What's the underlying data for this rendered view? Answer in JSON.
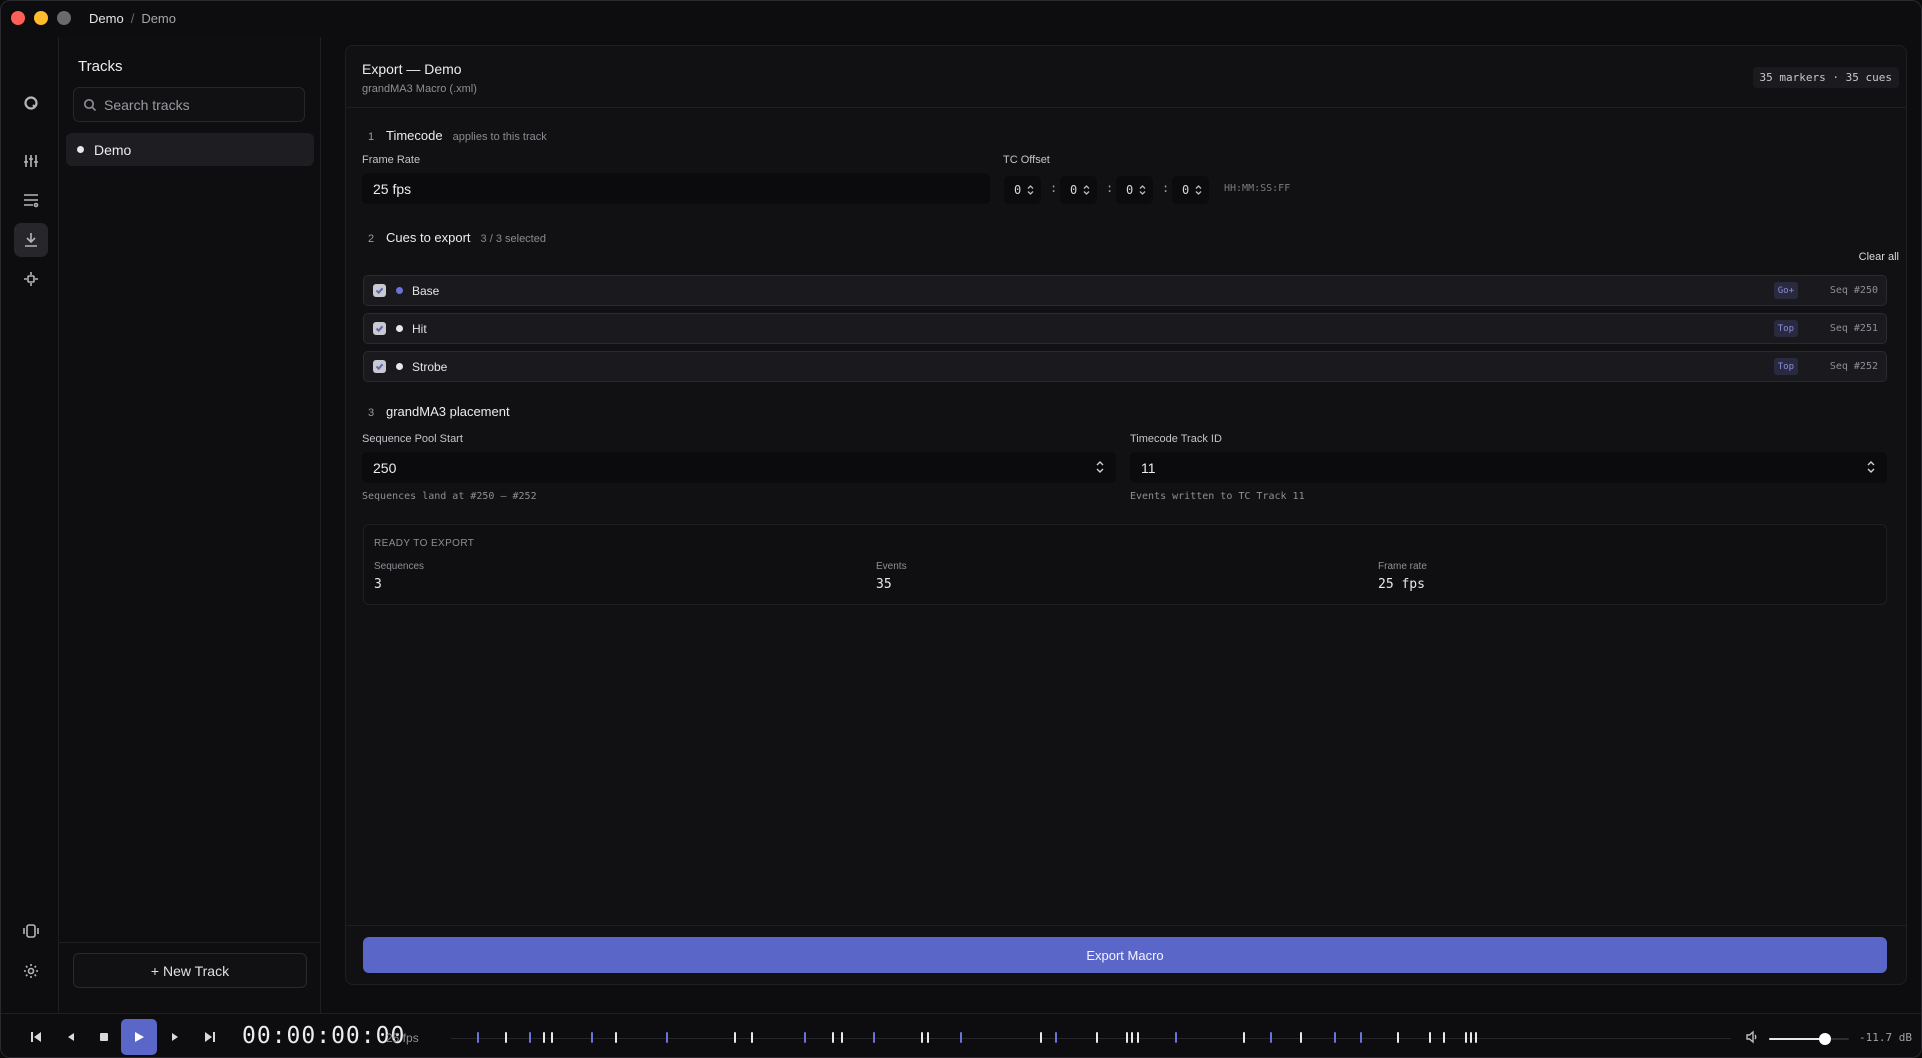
{
  "titlebar": {
    "crumb_root": "Demo",
    "crumb_sep": "/",
    "crumb_current": "Demo"
  },
  "rail": {
    "icons": [
      "logo-icon",
      "mixer-icon",
      "list-icon",
      "download-icon",
      "fixture-icon",
      "device-icon",
      "gear-icon"
    ],
    "active": "download-icon"
  },
  "sidebar": {
    "title": "Tracks",
    "search_placeholder": "Search tracks",
    "tracks": [
      {
        "name": "Demo"
      }
    ],
    "new_track_label": "+ New Track"
  },
  "export": {
    "title": "Export — Demo",
    "subtitle": "grandMA3 Macro (.xml)",
    "stats": "35 markers · 35 cues",
    "steps": [
      {
        "num": "1",
        "title": "Timecode",
        "hint": "applies to this track"
      },
      {
        "num": "2",
        "title": "Cues to export",
        "hint": "3 / 3 selected"
      },
      {
        "num": "3",
        "title": "grandMA3 placement",
        "hint": ""
      }
    ],
    "frame_rate_label": "Frame Rate",
    "frame_rate_value": "25 fps",
    "tc_offset_label": "TC Offset",
    "tc_offset": [
      "0",
      "0",
      "0",
      "0"
    ],
    "tc_sep": ":",
    "tc_format": "HH:MM:SS:FF",
    "clear_all": "Clear all",
    "cues": [
      {
        "name": "Base",
        "tag": "Go+",
        "seq": "Seq #250",
        "dot_color": "#6b74d6",
        "checked": true
      },
      {
        "name": "Hit",
        "tag": "Top",
        "seq": "Seq #251",
        "dot_color": "#e8e8ec",
        "checked": true
      },
      {
        "name": "Strobe",
        "tag": "Top",
        "seq": "Seq #252",
        "dot_color": "#e8e8ec",
        "checked": true
      }
    ],
    "seq_pool_label": "Sequence Pool Start",
    "seq_pool_value": "250",
    "seq_pool_help": "Sequences land at #250 – #252",
    "tc_track_label": "Timecode Track ID",
    "tc_track_value": "11",
    "tc_track_help": "Events written to TC Track 11",
    "ready": {
      "caption": "READY TO EXPORT",
      "items": [
        {
          "key": "Sequences",
          "value": "3"
        },
        {
          "key": "Events",
          "value": "35"
        },
        {
          "key": "Frame rate",
          "value": "25 fps"
        }
      ]
    },
    "export_button": "Export Macro"
  },
  "transport": {
    "timecode": "00:00:00:00",
    "fps": "25 fps",
    "volume_db": "-11.7 dB",
    "volume_level": 0.7,
    "accent": "#5b66c9",
    "markers": [
      {
        "t": 0.02,
        "c": "#6b74d6"
      },
      {
        "t": 0.042,
        "c": "#e8e8ec"
      },
      {
        "t": 0.061,
        "c": "#6b74d6"
      },
      {
        "t": 0.072,
        "c": "#e8e8ec"
      },
      {
        "t": 0.078,
        "c": "#e8e8ec"
      },
      {
        "t": 0.109,
        "c": "#6b74d6"
      },
      {
        "t": 0.128,
        "c": "#e8e8ec"
      },
      {
        "t": 0.168,
        "c": "#6b74d6"
      },
      {
        "t": 0.221,
        "c": "#e8e8ec"
      },
      {
        "t": 0.234,
        "c": "#e8e8ec"
      },
      {
        "t": 0.276,
        "c": "#6b74d6"
      },
      {
        "t": 0.298,
        "c": "#e8e8ec"
      },
      {
        "t": 0.305,
        "c": "#e8e8ec"
      },
      {
        "t": 0.33,
        "c": "#6b74d6"
      },
      {
        "t": 0.367,
        "c": "#e8e8ec"
      },
      {
        "t": 0.372,
        "c": "#e8e8ec"
      },
      {
        "t": 0.398,
        "c": "#6b74d6"
      },
      {
        "t": 0.46,
        "c": "#e8e8ec"
      },
      {
        "t": 0.472,
        "c": "#6b74d6"
      },
      {
        "t": 0.504,
        "c": "#e8e8ec"
      },
      {
        "t": 0.527,
        "c": "#e8e8ec"
      },
      {
        "t": 0.531,
        "c": "#e8e8ec"
      },
      {
        "t": 0.536,
        "c": "#e8e8ec"
      },
      {
        "t": 0.566,
        "c": "#6b74d6"
      },
      {
        "t": 0.619,
        "c": "#e8e8ec"
      },
      {
        "t": 0.64,
        "c": "#6b74d6"
      },
      {
        "t": 0.663,
        "c": "#e8e8ec"
      },
      {
        "t": 0.69,
        "c": "#6b74d6"
      },
      {
        "t": 0.71,
        "c": "#6b74d6"
      },
      {
        "t": 0.739,
        "c": "#e8e8ec"
      },
      {
        "t": 0.764,
        "c": "#e8e8ec"
      },
      {
        "t": 0.775,
        "c": "#e8e8ec"
      },
      {
        "t": 0.792,
        "c": "#e8e8ec"
      },
      {
        "t": 0.796,
        "c": "#e8e8ec"
      },
      {
        "t": 0.8,
        "c": "#e8e8ec"
      }
    ]
  }
}
